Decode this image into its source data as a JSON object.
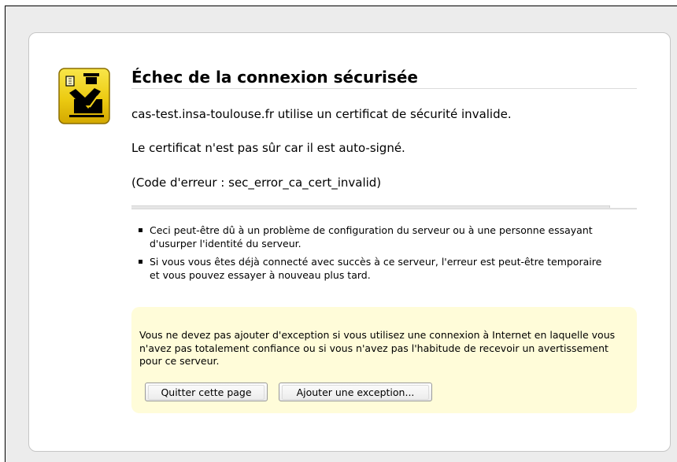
{
  "page": {
    "title": "Échec de la connexion sécurisée",
    "lines": [
      "cas-test.insa-toulouse.fr utilise un certificat de sécurité invalide.",
      "Le certificat n'est pas sûr car il est auto-signé.",
      "(Code d'erreur : sec_error_ca_cert_invalid)"
    ],
    "reasons": [
      "Ceci peut-être dû à un problème de configuration du serveur ou à une personne essayant d'usurper l'identité du serveur.",
      "Si vous vous êtes déjà connecté avec succès à ce serveur, l'erreur est peut-être temporaire et vous pouvez essayer à nouveau plus tard."
    ]
  },
  "warning": {
    "text": "Vous ne devez pas ajouter d'exception si vous utilisez une connexion à Internet en laquelle vous n'avez pas totalement confiance ou si vous n'avez pas l'habitude de recevoir un avertissement pour ce serveur.",
    "quit_label": "Quitter cette page",
    "exception_label": "Ajouter une exception..."
  },
  "icon": {
    "name": "security-officer-icon",
    "color": "#f2d21c"
  }
}
